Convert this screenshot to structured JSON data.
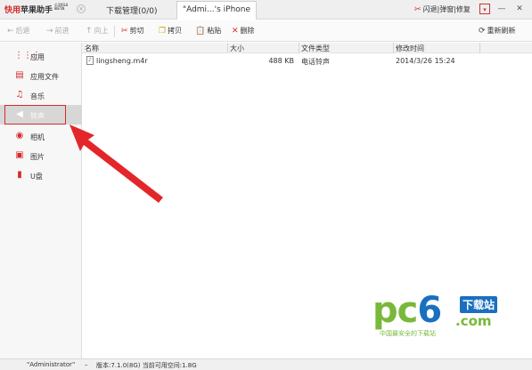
{
  "titlebar": {
    "app_brand": "快用",
    "app_name_rest": "苹果助手",
    "app_version_line1": "©2014",
    "app_version_line2": "BETA",
    "close_tab_glyph": "×",
    "downloads_tab": "下载管理(0/0)",
    "device_tab": "\"Admi...'s iPhone",
    "repair_label": "闪退|弹窗|修复",
    "repair_icon": "✂",
    "menu_glyph": "▾",
    "min_glyph": "—",
    "close_glyph": "✕"
  },
  "toolbar": {
    "back": {
      "icon": "←",
      "label": "后退"
    },
    "forward": {
      "icon": "→",
      "label": "前进"
    },
    "up": {
      "icon": "↑",
      "label": "向上"
    },
    "cut": {
      "icon": "✂",
      "label": "剪切"
    },
    "copy": {
      "icon": "❐",
      "label": "拷贝"
    },
    "paste": {
      "icon": "📋",
      "label": "粘贴"
    },
    "delete": {
      "icon": "✕",
      "label": "删除"
    },
    "refresh": {
      "icon": "⟳",
      "label": "重新刷新"
    }
  },
  "sidebar": {
    "items": [
      {
        "label": "应用",
        "icon": "⋮⋮⋮"
      },
      {
        "label": "应用文件",
        "icon": "▤"
      },
      {
        "label": "音乐",
        "icon": "♫"
      },
      {
        "label": "铃声",
        "icon": "◀"
      },
      {
        "label": "相机",
        "icon": "◉"
      },
      {
        "label": "图片",
        "icon": "▣"
      },
      {
        "label": "U盘",
        "icon": "▮"
      }
    ],
    "active_index": 3
  },
  "list": {
    "columns": [
      "名称",
      "大小",
      "文件类型",
      "修改时间"
    ],
    "rows": [
      {
        "name": "lingsheng.m4r",
        "size": "488 KB",
        "type": "电话铃声",
        "modified": "2014/3/26 15:24",
        "icon": "♪"
      }
    ]
  },
  "watermark": {
    "logo_main": "pc",
    "logo_six": "6",
    "badge": "下载站",
    "domain": ".com",
    "slogan": "中国最安全的下载站"
  },
  "statusbar": {
    "device": "\"Administrator\"",
    "separator": "–",
    "info": "版本:7.1.0(8G) 当前可用空间:1.8G"
  },
  "colors": {
    "accent_red": "#d6292b",
    "watermark_green": "#79b83a",
    "watermark_blue": "#1a6fbf"
  }
}
